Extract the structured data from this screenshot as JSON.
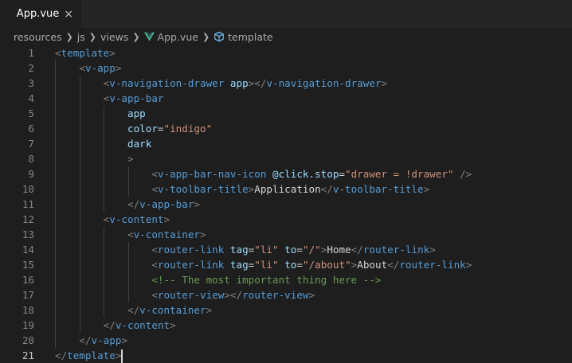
{
  "tab": {
    "filename": "App.vue",
    "close": "×"
  },
  "breadcrumb": [
    "resources",
    "js",
    "views",
    "App.vue",
    "template"
  ],
  "editor": {
    "active_line": 21,
    "lines": [
      {
        "n": "1",
        "indent": 0,
        "tokens": [
          [
            "punc",
            "<"
          ],
          [
            "tag",
            "template"
          ],
          [
            "punc",
            ">"
          ]
        ]
      },
      {
        "n": "2",
        "indent": 1,
        "tokens": [
          [
            "punc",
            "<"
          ],
          [
            "tag",
            "v-app"
          ],
          [
            "punc",
            ">"
          ]
        ]
      },
      {
        "n": "3",
        "indent": 2,
        "tokens": [
          [
            "punc",
            "<"
          ],
          [
            "tag",
            "v-navigation-drawer"
          ],
          [
            "plain",
            " "
          ],
          [
            "attr",
            "app"
          ],
          [
            "punc",
            "></"
          ],
          [
            "tag",
            "v-navigation-drawer"
          ],
          [
            "punc",
            ">"
          ]
        ]
      },
      {
        "n": "4",
        "indent": 2,
        "tokens": [
          [
            "punc",
            "<"
          ],
          [
            "tag",
            "v-app-bar"
          ]
        ]
      },
      {
        "n": "5",
        "indent": 3,
        "tokens": [
          [
            "attr",
            "app"
          ]
        ]
      },
      {
        "n": "6",
        "indent": 3,
        "tokens": [
          [
            "attr",
            "color"
          ],
          [
            "plain",
            "="
          ],
          [
            "str",
            "\"indigo\""
          ]
        ]
      },
      {
        "n": "7",
        "indent": 3,
        "tokens": [
          [
            "attr",
            "dark"
          ]
        ]
      },
      {
        "n": "8",
        "indent": 3,
        "tokens": [
          [
            "punc",
            ">"
          ]
        ]
      },
      {
        "n": "9",
        "indent": 4,
        "tokens": [
          [
            "punc",
            "<"
          ],
          [
            "tag",
            "v-app-bar-nav-icon"
          ],
          [
            "plain",
            " "
          ],
          [
            "attr",
            "@click.stop"
          ],
          [
            "plain",
            "="
          ],
          [
            "str",
            "\"drawer = !drawer\""
          ],
          [
            "plain",
            " "
          ],
          [
            "punc",
            "/>"
          ]
        ]
      },
      {
        "n": "10",
        "indent": 4,
        "tokens": [
          [
            "punc",
            "<"
          ],
          [
            "tag",
            "v-toolbar-title"
          ],
          [
            "punc",
            ">"
          ],
          [
            "text",
            "Application"
          ],
          [
            "punc",
            "</"
          ],
          [
            "tag",
            "v-toolbar-title"
          ],
          [
            "punc",
            ">"
          ]
        ]
      },
      {
        "n": "11",
        "indent": 3,
        "tokens": [
          [
            "punc",
            "</"
          ],
          [
            "tag",
            "v-app-bar"
          ],
          [
            "punc",
            ">"
          ]
        ]
      },
      {
        "n": "12",
        "indent": 2,
        "tokens": [
          [
            "punc",
            "<"
          ],
          [
            "tag",
            "v-content"
          ],
          [
            "punc",
            ">"
          ]
        ]
      },
      {
        "n": "13",
        "indent": 3,
        "tokens": [
          [
            "punc",
            "<"
          ],
          [
            "tag",
            "v-container"
          ],
          [
            "punc",
            ">"
          ]
        ]
      },
      {
        "n": "14",
        "indent": 4,
        "tokens": [
          [
            "punc",
            "<"
          ],
          [
            "tag",
            "router-link"
          ],
          [
            "plain",
            " "
          ],
          [
            "attr",
            "tag"
          ],
          [
            "plain",
            "="
          ],
          [
            "str",
            "\"li\""
          ],
          [
            "plain",
            " "
          ],
          [
            "attr",
            "to"
          ],
          [
            "plain",
            "="
          ],
          [
            "str",
            "\"/\""
          ],
          [
            "punc",
            ">"
          ],
          [
            "text",
            "Home"
          ],
          [
            "punc",
            "</"
          ],
          [
            "tag",
            "router-link"
          ],
          [
            "punc",
            ">"
          ]
        ]
      },
      {
        "n": "15",
        "indent": 4,
        "tokens": [
          [
            "punc",
            "<"
          ],
          [
            "tag",
            "router-link"
          ],
          [
            "plain",
            " "
          ],
          [
            "attr",
            "tag"
          ],
          [
            "plain",
            "="
          ],
          [
            "str",
            "\"li\""
          ],
          [
            "plain",
            " "
          ],
          [
            "attr",
            "to"
          ],
          [
            "plain",
            "="
          ],
          [
            "str",
            "\"/about\""
          ],
          [
            "punc",
            ">"
          ],
          [
            "text",
            "About"
          ],
          [
            "punc",
            "</"
          ],
          [
            "tag",
            "router-link"
          ],
          [
            "punc",
            ">"
          ]
        ]
      },
      {
        "n": "16",
        "indent": 4,
        "tokens": [
          [
            "comment",
            "<!-- The most important thing here -->"
          ]
        ]
      },
      {
        "n": "17",
        "indent": 4,
        "tokens": [
          [
            "punc",
            "<"
          ],
          [
            "tag",
            "router-view"
          ],
          [
            "punc",
            "></"
          ],
          [
            "tag",
            "router-view"
          ],
          [
            "punc",
            ">"
          ]
        ]
      },
      {
        "n": "18",
        "indent": 3,
        "tokens": [
          [
            "punc",
            "</"
          ],
          [
            "tag",
            "v-container"
          ],
          [
            "punc",
            ">"
          ]
        ]
      },
      {
        "n": "19",
        "indent": 2,
        "tokens": [
          [
            "punc",
            "</"
          ],
          [
            "tag",
            "v-content"
          ],
          [
            "punc",
            ">"
          ]
        ]
      },
      {
        "n": "20",
        "indent": 1,
        "tokens": [
          [
            "punc",
            "</"
          ],
          [
            "tag",
            "v-app"
          ],
          [
            "punc",
            ">"
          ]
        ]
      },
      {
        "n": "21",
        "indent": 0,
        "tokens": [
          [
            "punc",
            "</"
          ],
          [
            "tag",
            "template"
          ],
          [
            "punc",
            ">"
          ]
        ]
      }
    ]
  },
  "colors": {
    "background": "#1e1e1e",
    "tag": "#569cd6",
    "attribute": "#9cdcfe",
    "string": "#ce9178",
    "comment": "#6a9955",
    "vue_green": "#41b883"
  }
}
